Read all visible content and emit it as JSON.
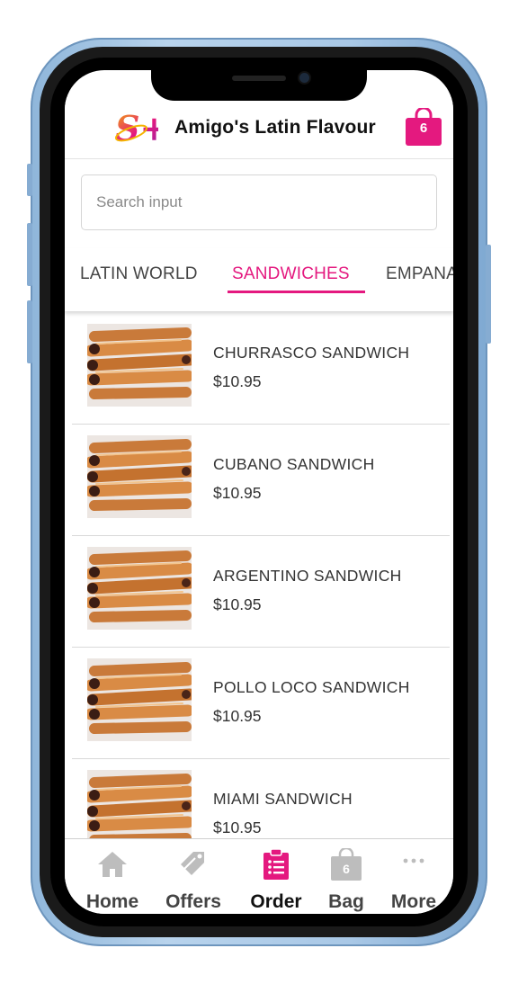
{
  "app": {
    "title": "Amigo's Latin Flavour",
    "logo_text": "S+",
    "bag_count": "6"
  },
  "search": {
    "placeholder": "Search input",
    "value": ""
  },
  "tabs": [
    {
      "label": "LATIN WORLD",
      "active": false
    },
    {
      "label": "SANDWICHES",
      "active": true
    },
    {
      "label": "EMPANA",
      "active": false
    }
  ],
  "products": [
    {
      "name": "CHURRASCO SANDWICH",
      "price": "$10.95"
    },
    {
      "name": "CUBANO SANDWICH",
      "price": "$10.95"
    },
    {
      "name": "ARGENTINO SANDWICH",
      "price": "$10.95"
    },
    {
      "name": "POLLO LOCO SANDWICH",
      "price": "$10.95"
    },
    {
      "name": "MIAMI SANDWICH",
      "price": "$10.95"
    }
  ],
  "bottom_nav": [
    {
      "label": "Home",
      "icon": "home-icon",
      "active": false
    },
    {
      "label": "Offers",
      "icon": "tag-icon",
      "active": false
    },
    {
      "label": "Order",
      "icon": "clipboard-list-icon",
      "active": true
    },
    {
      "label": "Bag",
      "icon": "bag-icon",
      "active": false,
      "badge": "6"
    },
    {
      "label": "More",
      "icon": "more-dots-icon",
      "active": false
    }
  ],
  "colors": {
    "accent": "#e4197f",
    "inactive_icon": "#bdbdbd",
    "frame": "#a9c8e6"
  }
}
